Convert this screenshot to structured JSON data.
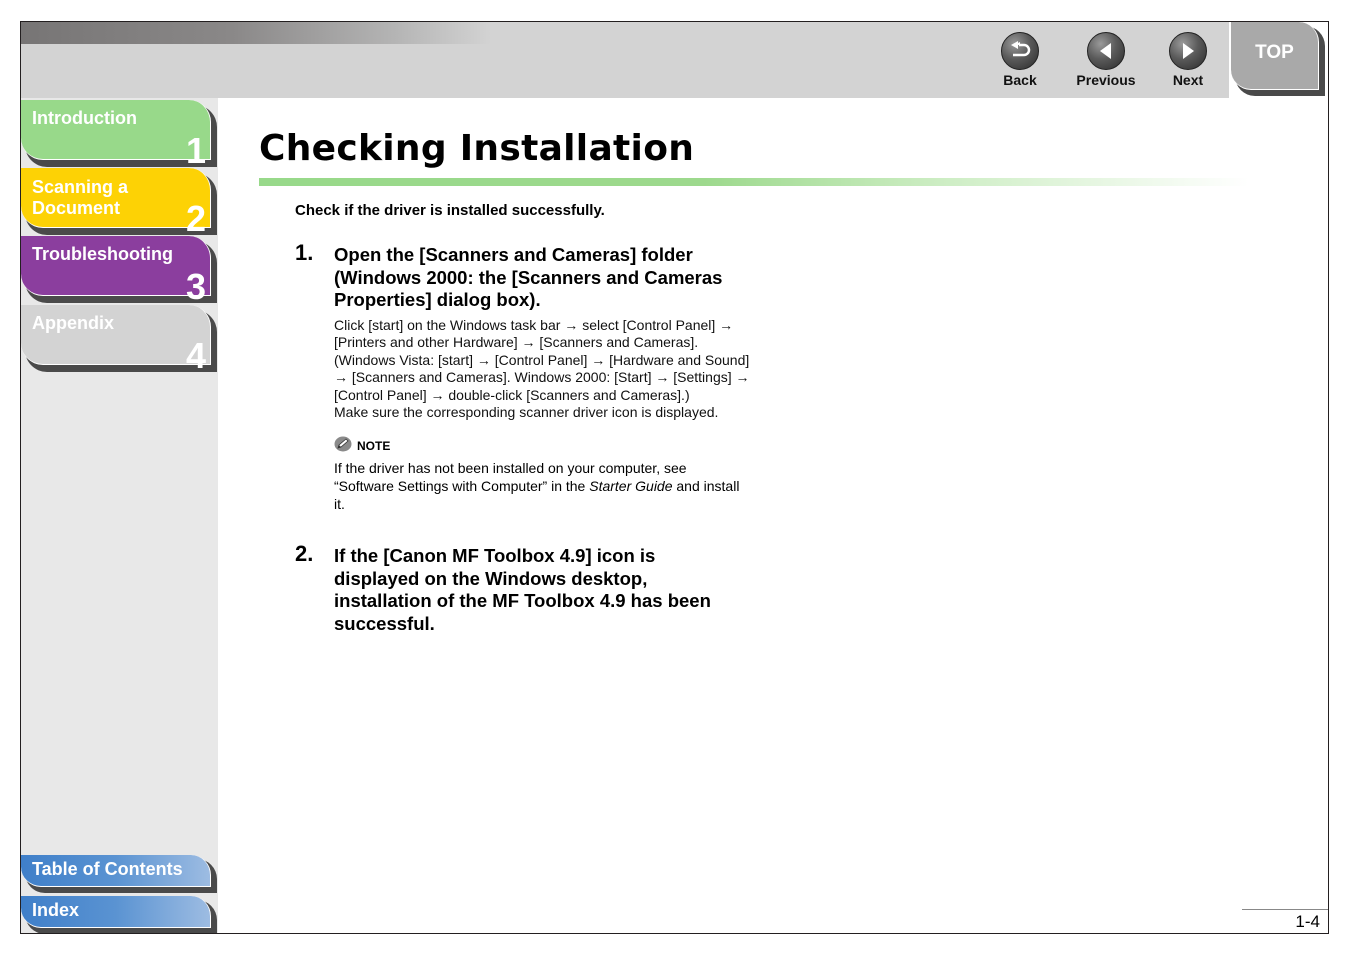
{
  "header": {
    "nav": [
      {
        "label": "Back",
        "icon": "back-arrow-icon"
      },
      {
        "label": "Previous",
        "icon": "left-triangle-icon"
      },
      {
        "label": "Next",
        "icon": "right-triangle-icon"
      }
    ],
    "top_label": "TOP"
  },
  "sidebar": {
    "chapters": [
      {
        "title": "Introduction",
        "number": "1",
        "color": "#98d98a"
      },
      {
        "title": "Scanning a Document",
        "title_lines": [
          "Scanning a",
          "Document"
        ],
        "number": "2",
        "color": "#fdd205"
      },
      {
        "title": "Troubleshooting",
        "number": "3",
        "color": "#8b3e9e"
      },
      {
        "title": "Appendix",
        "number": "4",
        "color": "#d3d3d3"
      }
    ],
    "toc_label": "Table of Contents",
    "index_label": "Index"
  },
  "main": {
    "title": "Checking Installation",
    "intro": "Check if the driver is installed successfully.",
    "steps": [
      {
        "number": "1.",
        "heading": "Open the [Scanners and Cameras] folder (Windows 2000: the [Scanners and Cameras Properties] dialog box).",
        "body": "Click [start] on the Windows task bar → select [Control Panel] → [Printers and other Hardware] → [Scanners and Cameras]. (Windows Vista: [start] → [Control Panel] → [Hardware and Sound] → [Scanners and Cameras]. Windows 2000: [Start] → [Settings] → [Control Panel] → double-click [Scanners and Cameras].)",
        "body2": "Make sure the corresponding scanner driver icon is displayed.",
        "note": {
          "label": "NOTE",
          "text_before": "If the driver has not been installed on your computer, see “Software Settings with Computer” in the ",
          "text_italic": "Starter Guide",
          "text_after": " and install it."
        }
      },
      {
        "number": "2.",
        "heading": "If the [Canon MF Toolbox 4.9] icon is displayed on the Windows desktop, installation of the MF Toolbox 4.9 has been successful."
      }
    ]
  },
  "footer": {
    "page_number": "1-4"
  }
}
